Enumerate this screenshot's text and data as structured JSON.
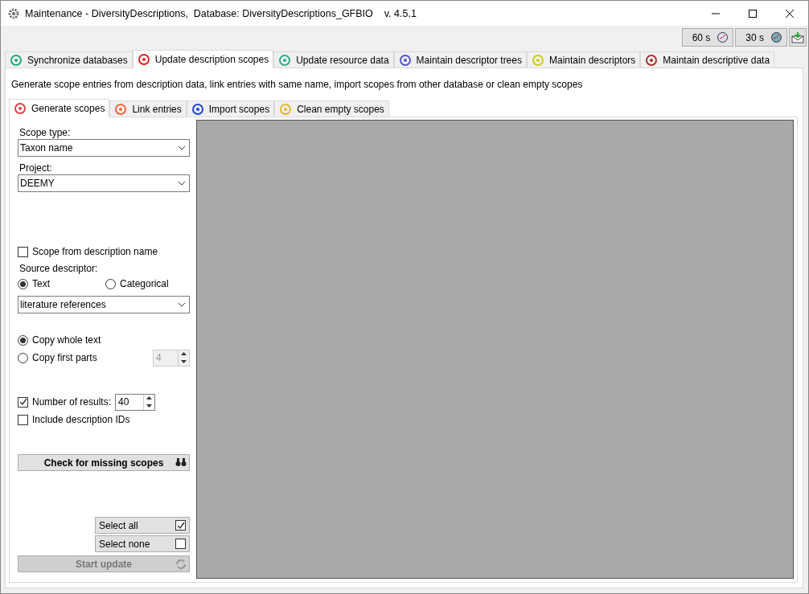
{
  "window": {
    "title": "Maintenance - DiversityDescriptions,  Database: DiversityDescriptions_GFBIO",
    "version": "v. 4.5.1"
  },
  "timers": [
    {
      "label": "60 s"
    },
    {
      "label": "30 s"
    }
  ],
  "main_tabs": [
    {
      "label": "Synchronize databases",
      "selected": false
    },
    {
      "label": "Update description scopes",
      "selected": true
    },
    {
      "label": "Update resource data",
      "selected": false
    },
    {
      "label": "Maintain descriptor trees",
      "selected": false
    },
    {
      "label": "Maintain descriptors",
      "selected": false
    },
    {
      "label": "Maintain descriptive data",
      "selected": false
    }
  ],
  "description": "Generate scope entries from description data, link entries with same name, import scopes from other database or clean empty scopes",
  "sub_tabs": [
    {
      "label": "Generate scopes",
      "selected": true
    },
    {
      "label": "Link entries",
      "selected": false
    },
    {
      "label": "Import scopes",
      "selected": false
    },
    {
      "label": "Clean empty scopes",
      "selected": false
    }
  ],
  "form": {
    "scope_type": {
      "label": "Scope type:",
      "value": "Taxon name"
    },
    "project": {
      "label": "Project:",
      "value": "DEEMY"
    },
    "scope_from_description_name": {
      "label": "Scope from description name",
      "checked": false
    },
    "source_descriptor": {
      "label": "Source descriptor:",
      "options": [
        {
          "label": "Text",
          "selected": true
        },
        {
          "label": "Categorical",
          "selected": false
        }
      ],
      "value": "literature references"
    },
    "copy_mode": [
      {
        "label": "Copy whole text",
        "selected": true
      },
      {
        "label": "Copy first parts",
        "selected": false
      }
    ],
    "parts_spinner": {
      "value": "4",
      "disabled": true
    },
    "number_of_results": {
      "label": "Number of results:",
      "checked": true,
      "value": "40"
    },
    "include_description_ids": {
      "label": "Include description IDs",
      "checked": false
    },
    "check_button": {
      "label": "Check for missing scopes"
    },
    "select_all": {
      "label": "Select all",
      "checked": true
    },
    "select_none": {
      "label": "Select none",
      "checked": false
    },
    "start_button": {
      "label": "Start update",
      "disabled": true
    }
  }
}
